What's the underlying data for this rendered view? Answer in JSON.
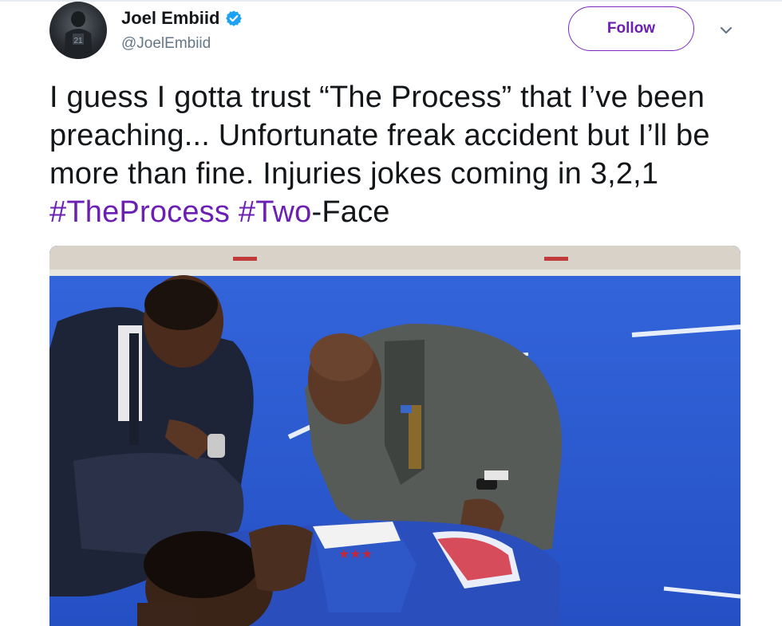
{
  "author": {
    "display_name": "Joel Embiid",
    "handle": "@JoelEmbiid",
    "verified": true,
    "avatar_icon": "profile-photo-icon"
  },
  "actions": {
    "follow_label": "Follow",
    "more_icon": "chevron-down-icon"
  },
  "tweet": {
    "text_part_1": "I guess I gotta trust “The Process” that I’ve been preaching... Unfortunate freak accident but I’ll be more than fine. Injuries jokes coming in 3,2,1 ",
    "hashtag_1": "#TheProcess",
    "text_part_2": " ",
    "hashtag_2": "#Two",
    "text_part_3": "-Face"
  },
  "media": {
    "description_icon": "photo-icon"
  },
  "colors": {
    "accent": "#6b1fb3",
    "text": "#14171a",
    "secondary_text": "#657786",
    "verified": "#1da1f2"
  }
}
